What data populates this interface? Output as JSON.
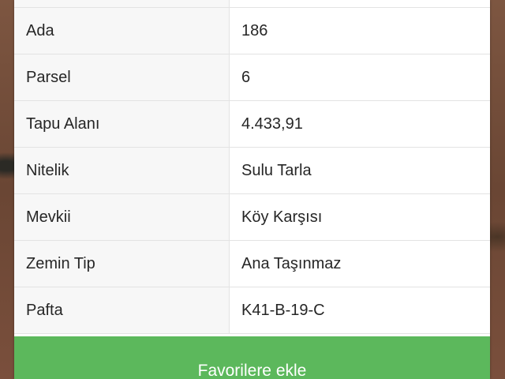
{
  "parcel_details": {
    "rows": [
      {
        "label": "Ada",
        "value": "186"
      },
      {
        "label": "Parsel",
        "value": "6"
      },
      {
        "label": "Tapu Alanı",
        "value": "4.433,91"
      },
      {
        "label": "Nitelik",
        "value": "Sulu Tarla"
      },
      {
        "label": "Mevkii",
        "value": "Köy Karşısı"
      },
      {
        "label": "Zemin Tip",
        "value": "Ana Taşınmaz"
      },
      {
        "label": "Pafta",
        "value": "K41-B-19-C"
      }
    ]
  },
  "favorites_button": {
    "label": "Favorilere ekle",
    "color": "#5cb85c"
  }
}
